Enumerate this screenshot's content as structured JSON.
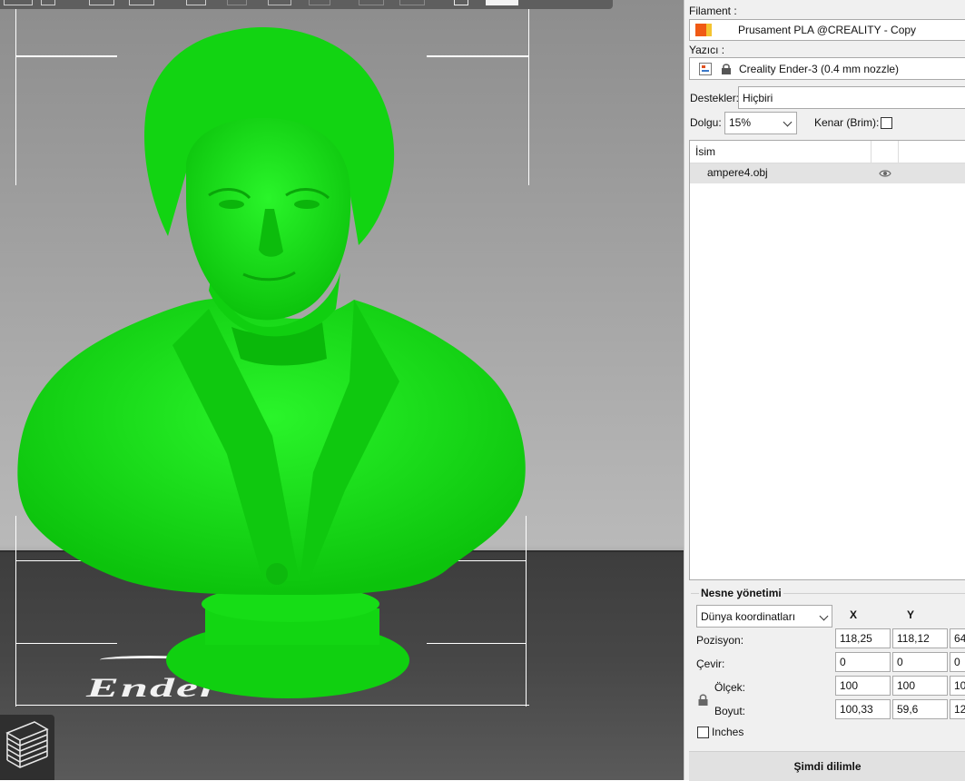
{
  "panel": {
    "filament_label": "Filament :",
    "filament_value": "Prusament PLA @CREALITY - Copy",
    "filament_colors": [
      "#f05a14",
      "#f4c430"
    ],
    "printer_label": "Yazıcı :",
    "printer_value": "Creality Ender-3 (0.4 mm nozzle)",
    "supports_label": "Destekler:",
    "supports_value": "Hiçbiri",
    "infill_label": "Dolgu:",
    "infill_value": "15%",
    "brim_label": "Kenar (Brim):",
    "brim_checked": false
  },
  "object_list": {
    "column_name": "İsim",
    "rows": [
      {
        "name": "ampere4.obj",
        "visible_icon": "eye-icon"
      }
    ]
  },
  "object_manipulation": {
    "title": "Nesne yönetimi",
    "coord_system": "Dünya koordinatları",
    "headers": {
      "x": "X",
      "y": "Y"
    },
    "position_label": "Pozisyon:",
    "position": {
      "x": "118,25",
      "y": "118,12",
      "z": "64"
    },
    "rotate_label": "Çevir:",
    "rotate": {
      "x": "0",
      "y": "0",
      "z": "0"
    },
    "scale_label": "Ölçek:",
    "scale": {
      "x": "100",
      "y": "100",
      "z": "10"
    },
    "size_label": "Boyut:",
    "size": {
      "x": "100,33",
      "y": "59,6",
      "z": "12"
    },
    "inches_label": "Inches",
    "inches_checked": false
  },
  "slice_button_label": "Şimdi dilimle",
  "bed_logo_text": "Ender",
  "colors": {
    "model_green": "#14e414",
    "panel_bg": "#f0f0f0",
    "bed": "#474747"
  }
}
